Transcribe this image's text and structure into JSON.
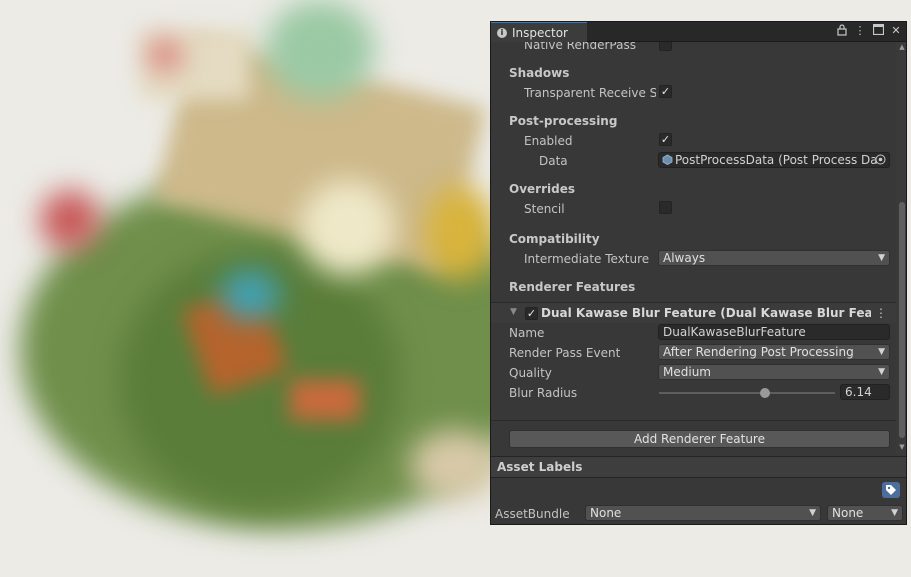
{
  "window": {
    "tab_title": "Inspector"
  },
  "titlebar_icons": [
    "lock-icon",
    "kebab-menu-icon",
    "maximize-icon",
    "close-icon"
  ],
  "settings": {
    "native_renderpass_label": "Native RenderPass",
    "shadows_header": "Shadows",
    "transparent_receive_shadows_label": "Transparent Receive Sh",
    "transparent_receive_shadows_checked": true,
    "post_processing_header": "Post-processing",
    "enabled_label": "Enabled",
    "enabled_checked": true,
    "data_label": "Data",
    "data_value": "PostProcessData (Post Process Da",
    "overrides_header": "Overrides",
    "stencil_label": "Stencil",
    "stencil_checked": false,
    "compatibility_header": "Compatibility",
    "intermediate_texture_label": "Intermediate Texture",
    "intermediate_texture_value": "Always",
    "renderer_features_header": "Renderer Features"
  },
  "feature": {
    "title": "Dual Kawase Blur Feature (Dual Kawase Blur Feature",
    "enabled": true,
    "name_label": "Name",
    "name_value": "DualKawaseBlurFeature",
    "render_pass_event_label": "Render Pass Event",
    "render_pass_event_value": "After Rendering Post Processing",
    "quality_label": "Quality",
    "quality_value": "Medium",
    "blur_radius_label": "Blur Radius",
    "blur_radius_value": "6.14",
    "blur_radius_fraction": 0.6
  },
  "add_renderer_feature_label": "Add Renderer Feature",
  "asset_labels": {
    "header": "Asset Labels",
    "assetbundle_label": "AssetBundle",
    "assetbundle_value": "None",
    "variant_value": "None"
  }
}
